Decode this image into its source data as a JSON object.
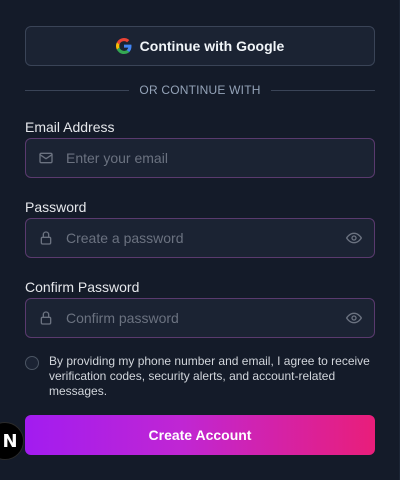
{
  "google": {
    "label": "Continue with Google",
    "icon": "google-icon"
  },
  "divider": {
    "text": "OR CONTINUE WITH"
  },
  "email": {
    "label": "Email Address",
    "placeholder": "Enter your email",
    "value": "",
    "icon": "mail-icon"
  },
  "password": {
    "label": "Password",
    "placeholder": "Create a password",
    "value": "",
    "icon": "lock-icon",
    "toggle_icon": "eye-icon"
  },
  "confirm": {
    "label": "Confirm Password",
    "placeholder": "Confirm password",
    "value": "",
    "icon": "lock-icon",
    "toggle_icon": "eye-icon"
  },
  "consent": {
    "checked": false,
    "text": "By providing my phone number and email, I agree to receive verification codes, security alerts, and account-related messages."
  },
  "submit": {
    "label": "Create Account"
  },
  "fab": {
    "glyph": "N"
  },
  "colors": {
    "background": "#141b29",
    "field_border": "#5a3a6e",
    "gradient_start": "#a21cf0",
    "gradient_end": "#e91e7a"
  }
}
